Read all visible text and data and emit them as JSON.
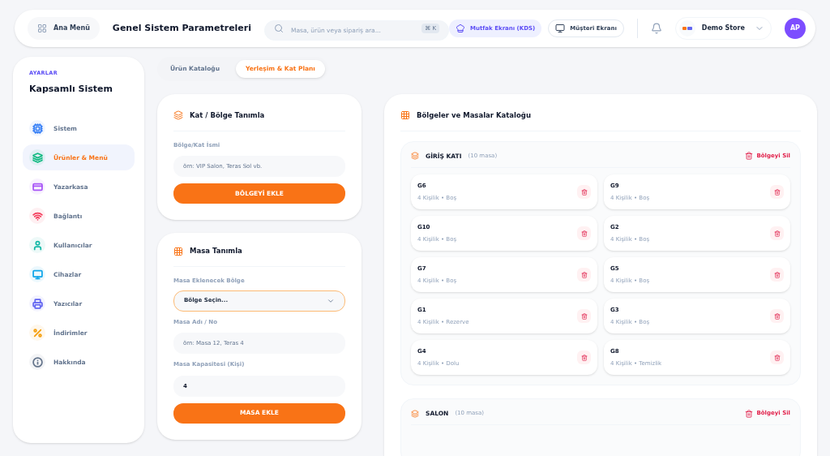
{
  "header": {
    "menu_button": "Ana Menü",
    "title": "Genel Sistem Parametreleri",
    "search": {
      "placeholder": "Masa, ürün veya sipariş ara...",
      "shortcut": "⌘ K"
    },
    "buttons": [
      {
        "label": "Mutfak Ekranı (KDS)",
        "selected": true
      },
      {
        "label": "Müşteri Ekranı",
        "selected": false
      }
    ],
    "store": {
      "name": "Demo Store"
    },
    "avatar": "AP"
  },
  "sidebar": {
    "overline": "AYARLAR",
    "title": "Kapsamlı Sistem",
    "items": [
      {
        "label": "Sistem",
        "color": "#3b82f6",
        "selected": false
      },
      {
        "label": "Ürünler & Menü",
        "color": "#10b981",
        "selected": true
      },
      {
        "label": "Yazarkasa",
        "color": "#a855f7",
        "selected": false
      },
      {
        "label": "Bağlantı",
        "color": "#f43f5e",
        "selected": false
      },
      {
        "label": "Kullanıcılar",
        "color": "#14b8a6",
        "selected": false
      },
      {
        "label": "Cihazlar",
        "color": "#0ea5e9",
        "selected": false
      },
      {
        "label": "Yazıcılar",
        "color": "#6366f1",
        "selected": false
      },
      {
        "label": "İndirimler",
        "color": "#f59e0b",
        "selected": false
      },
      {
        "label": "Hakkında",
        "color": "#64748b",
        "selected": false
      }
    ]
  },
  "tabs": [
    {
      "label": "Ürün Kataloğu",
      "selected": false
    },
    {
      "label": "Yerleşim & Kat Planı",
      "selected": true
    }
  ],
  "zone_form": {
    "title": "Kat / Bölge Tanımla",
    "field_label": "Bölge/Kat İsmi",
    "placeholder": "örn: VIP Salon, Teras Sol vb.",
    "button": "BÖLGEYİ EKLE"
  },
  "table_form": {
    "title": "Masa Tanımla",
    "zone_label": "Masa Eklenecek Bölge",
    "zone_value": "Bölge Seçin...",
    "name_label": "Masa Adı / No",
    "name_placeholder": "örn: Masa 12, Teras 4",
    "capacity_label": "Masa Kapasitesi (Kişi)",
    "capacity_value": "4",
    "button": "MASA EKLE"
  },
  "catalog": {
    "title": "Bölgeler ve Masalar Kataloğu",
    "zones": [
      {
        "name": "GİRİŞ KATI",
        "count": "(10 masa)",
        "delete": "Bölgeyi Sil",
        "tables": [
          {
            "name": "G6",
            "info": "4 Kişilik • Boş"
          },
          {
            "name": "G9",
            "info": "4 Kişilik • Boş"
          },
          {
            "name": "G10",
            "info": "4 Kişilik • Boş"
          },
          {
            "name": "G2",
            "info": "4 Kişilik • Boş"
          },
          {
            "name": "G7",
            "info": "4 Kişilik • Boş"
          },
          {
            "name": "G5",
            "info": "4 Kişilik • Boş"
          },
          {
            "name": "G1",
            "info": "4 Kişilik • Rezerve"
          },
          {
            "name": "G3",
            "info": "4 Kişilik • Boş"
          },
          {
            "name": "G4",
            "info": "4 Kişilik • Dolu"
          },
          {
            "name": "G8",
            "info": "4 Kişilik • Temizlik"
          }
        ]
      },
      {
        "name": "SALON",
        "count": "(10 masa)",
        "delete": "Bölgeyi Sil"
      }
    ]
  }
}
